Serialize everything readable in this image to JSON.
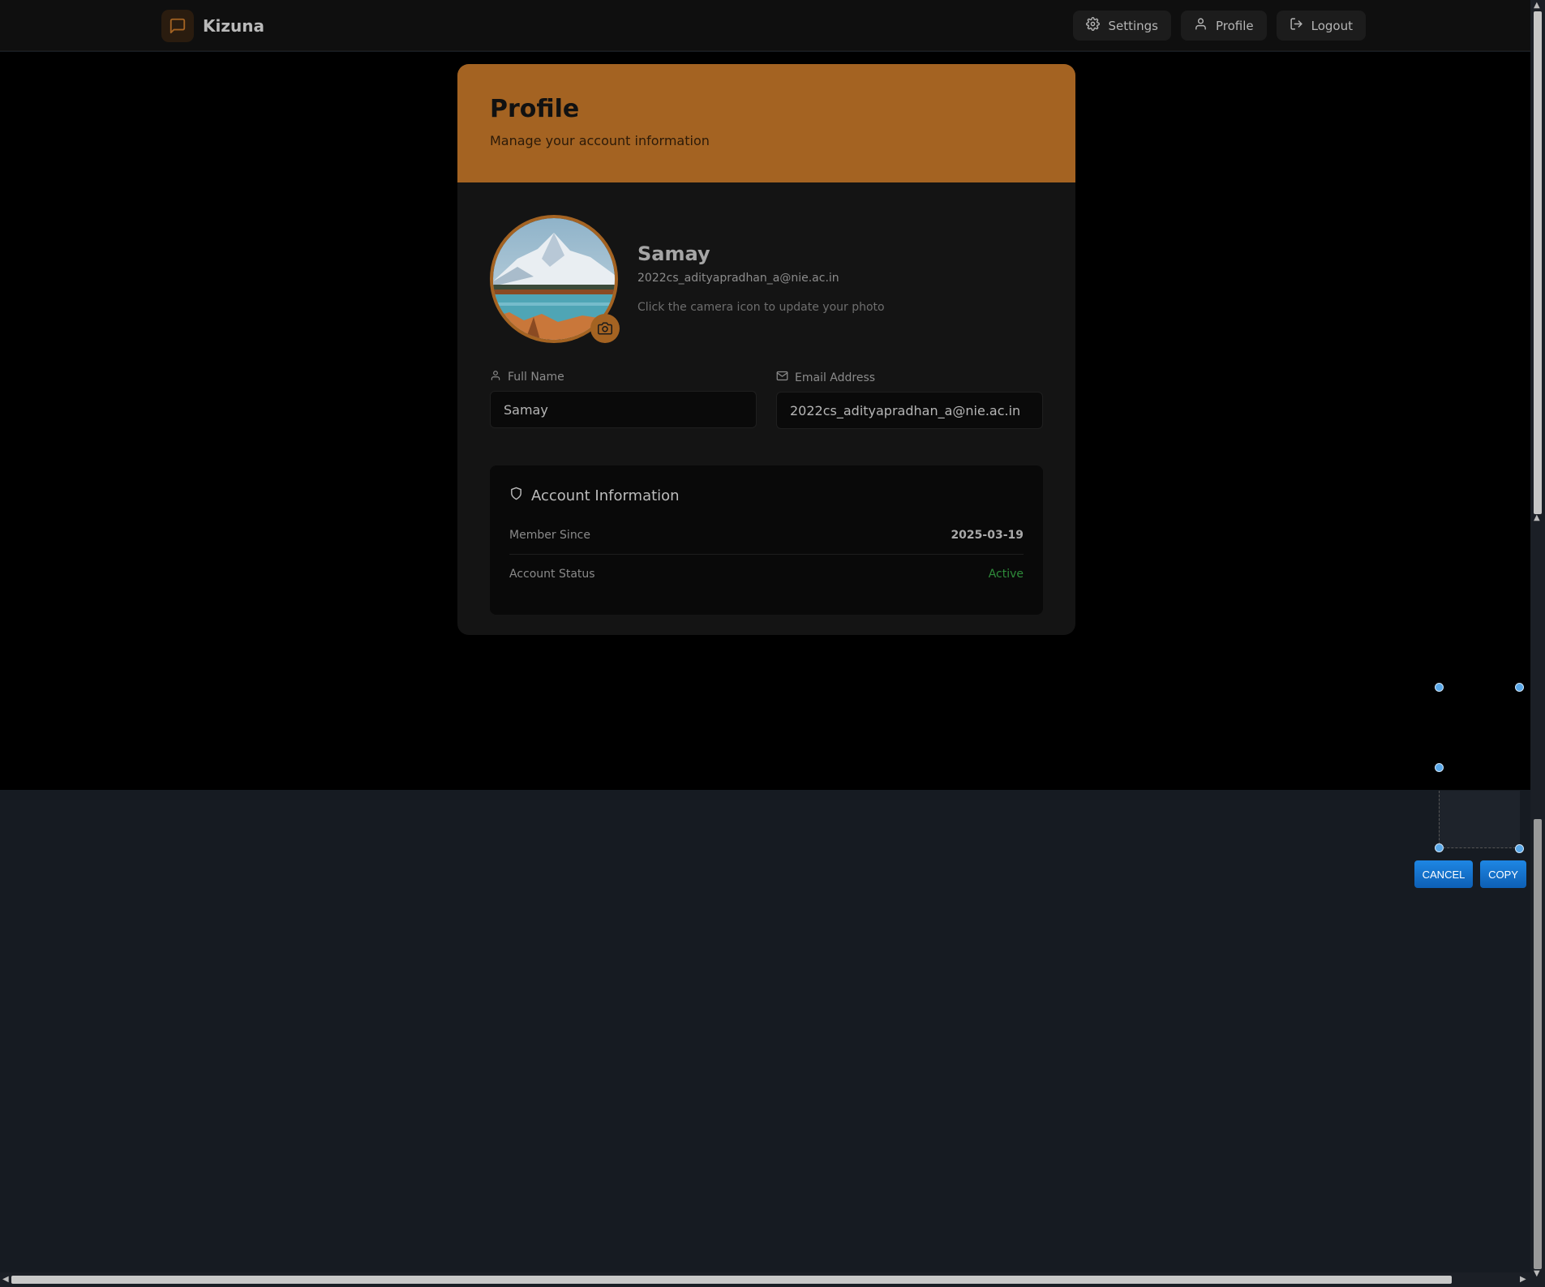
{
  "app": {
    "name": "Kizuna",
    "logo_icon": "chat-bubble-icon",
    "accent": "#a46322"
  },
  "nav": {
    "settings_label": "Settings",
    "profile_label": "Profile",
    "logout_label": "Logout"
  },
  "profile": {
    "title": "Profile",
    "subtitle": "Manage your account information",
    "name": "Samay",
    "email": "2022cs_adityapradhan_a@nie.ac.in",
    "photo_hint": "Click the camera icon to update your photo"
  },
  "form": {
    "full_name_label": "Full Name",
    "full_name_value": "Samay",
    "email_label": "Email Address",
    "email_value": "2022cs_adityapradhan_a@nie.ac.in"
  },
  "account": {
    "title": "Account Information",
    "member_since_label": "Member Since",
    "member_since_value": "2025-03-19",
    "status_label": "Account Status",
    "status_value": "Active",
    "status_color": "#2e8b3a"
  },
  "capture": {
    "cancel_label": "CANCEL",
    "copy_label": "COPY"
  }
}
